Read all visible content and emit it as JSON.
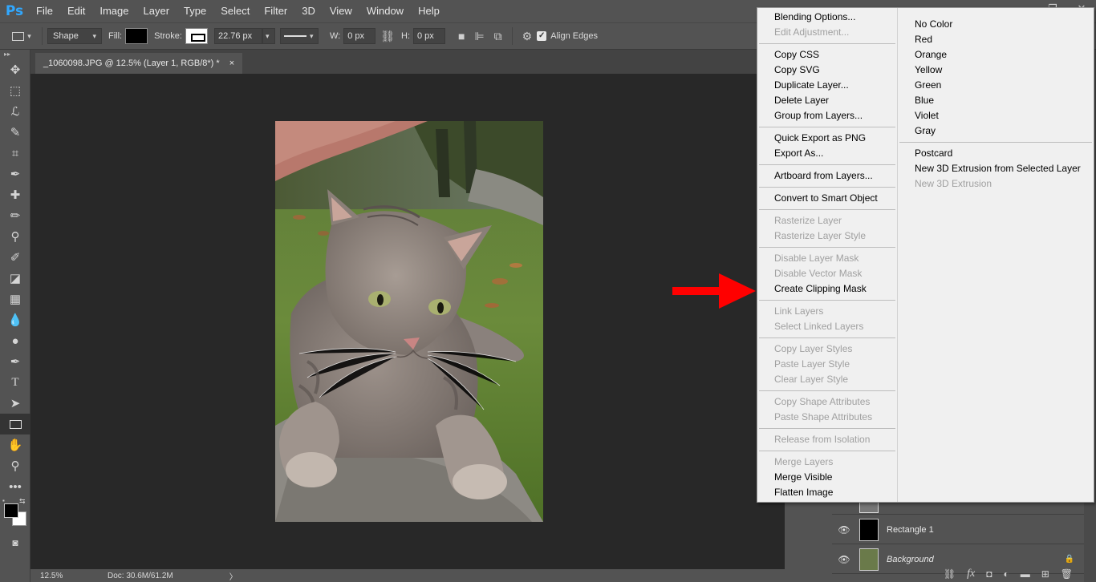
{
  "app": {
    "logo": "Ps"
  },
  "menubar": [
    "File",
    "Edit",
    "Image",
    "Layer",
    "Type",
    "Select",
    "Filter",
    "3D",
    "View",
    "Window",
    "Help"
  ],
  "window_controls": {
    "minimize": "—",
    "restore": "❐",
    "close": "✕"
  },
  "options_bar": {
    "mode": "Shape",
    "fill_label": "Fill:",
    "stroke_label": "Stroke:",
    "stroke_width": "22.76 px",
    "w_label": "W:",
    "w_value": "0 px",
    "h_label": "H:",
    "h_value": "0 px",
    "align_edges_label": "Align Edges",
    "align_edges_checked": true
  },
  "document_tab": {
    "title": "_1060098.JPG @ 12.5% (Layer 1, RGB/8*) *",
    "close": "×"
  },
  "status": {
    "zoom": "12.5%",
    "doc": "Doc: 30.6M/61.2M",
    "arrow": "〉"
  },
  "toolbar_collapse": "▸▸",
  "tools": [
    "move-tool",
    "marquee-tool",
    "lasso-tool",
    "quick-select-tool",
    "crop-tool",
    "eyedropper-tool",
    "healing-brush-tool",
    "brush-tool",
    "clone-stamp-tool",
    "history-brush-tool",
    "eraser-tool",
    "gradient-tool",
    "blur-tool",
    "dodge-tool",
    "pen-tool",
    "type-tool",
    "path-select-tool",
    "rectangle-tool",
    "hand-tool",
    "zoom-tool",
    "more-tools"
  ],
  "tool_glyphs": [
    "✥",
    "⬚",
    "ℒ",
    "✎",
    "⌗",
    "✒",
    "✚",
    "✏",
    "⚲",
    "✐",
    "◪",
    "▦",
    "💧",
    "●",
    "✒",
    "T",
    "➤",
    "",
    "✋",
    "⚲",
    "•••"
  ],
  "context_menu": {
    "column1": [
      [
        {
          "label": "Blending Options...",
          "enabled": true
        },
        {
          "label": "Edit Adjustment...",
          "enabled": false
        }
      ],
      [
        {
          "label": "Copy CSS",
          "enabled": true
        },
        {
          "label": "Copy SVG",
          "enabled": true
        },
        {
          "label": "Duplicate Layer...",
          "enabled": true
        },
        {
          "label": "Delete Layer",
          "enabled": true
        },
        {
          "label": "Group from Layers...",
          "enabled": true
        }
      ],
      [
        {
          "label": "Quick Export as PNG",
          "enabled": true
        },
        {
          "label": "Export As...",
          "enabled": true
        }
      ],
      [
        {
          "label": "Artboard from Layers...",
          "enabled": true
        }
      ],
      [
        {
          "label": "Convert to Smart Object",
          "enabled": true
        }
      ],
      [
        {
          "label": "Rasterize Layer",
          "enabled": false
        },
        {
          "label": "Rasterize Layer Style",
          "enabled": false
        }
      ],
      [
        {
          "label": "Disable Layer Mask",
          "enabled": false
        },
        {
          "label": "Disable Vector Mask",
          "enabled": false
        },
        {
          "label": "Create Clipping Mask",
          "enabled": true
        }
      ],
      [
        {
          "label": "Link Layers",
          "enabled": false
        },
        {
          "label": "Select Linked Layers",
          "enabled": false
        }
      ],
      [
        {
          "label": "Copy Layer Styles",
          "enabled": false
        },
        {
          "label": "Paste Layer Style",
          "enabled": false
        },
        {
          "label": "Clear Layer Style",
          "enabled": false
        }
      ],
      [
        {
          "label": "Copy Shape Attributes",
          "enabled": false
        },
        {
          "label": "Paste Shape Attributes",
          "enabled": false
        }
      ],
      [
        {
          "label": "Release from Isolation",
          "enabled": false
        }
      ],
      [
        {
          "label": "Merge Layers",
          "enabled": false
        },
        {
          "label": "Merge Visible",
          "enabled": true
        },
        {
          "label": "Flatten Image",
          "enabled": true
        }
      ]
    ],
    "column2": [
      [
        {
          "label": "No Color",
          "enabled": true
        },
        {
          "label": "Red",
          "enabled": true
        },
        {
          "label": "Orange",
          "enabled": true
        },
        {
          "label": "Yellow",
          "enabled": true
        },
        {
          "label": "Green",
          "enabled": true
        },
        {
          "label": "Blue",
          "enabled": true
        },
        {
          "label": "Violet",
          "enabled": true
        },
        {
          "label": "Gray",
          "enabled": true
        }
      ],
      [
        {
          "label": "Postcard",
          "enabled": true
        },
        {
          "label": "New 3D Extrusion from Selected Layer",
          "enabled": true
        },
        {
          "label": "New 3D Extrusion",
          "enabled": false
        }
      ]
    ]
  },
  "layers": [
    {
      "name": "Rectangle 1",
      "visible": true
    },
    {
      "name": "Background",
      "visible": true,
      "locked": true
    }
  ],
  "layers_footer": [
    "⛓",
    "fx",
    "◘",
    "◐",
    "▬",
    "⊞",
    "🗑"
  ],
  "colors": {
    "arrow": "#ff0000",
    "menu_bg": "#f0f0f0",
    "canvas_bg": "#282828",
    "ui_bg": "#535353",
    "ps_blue": "#31a8ff"
  }
}
